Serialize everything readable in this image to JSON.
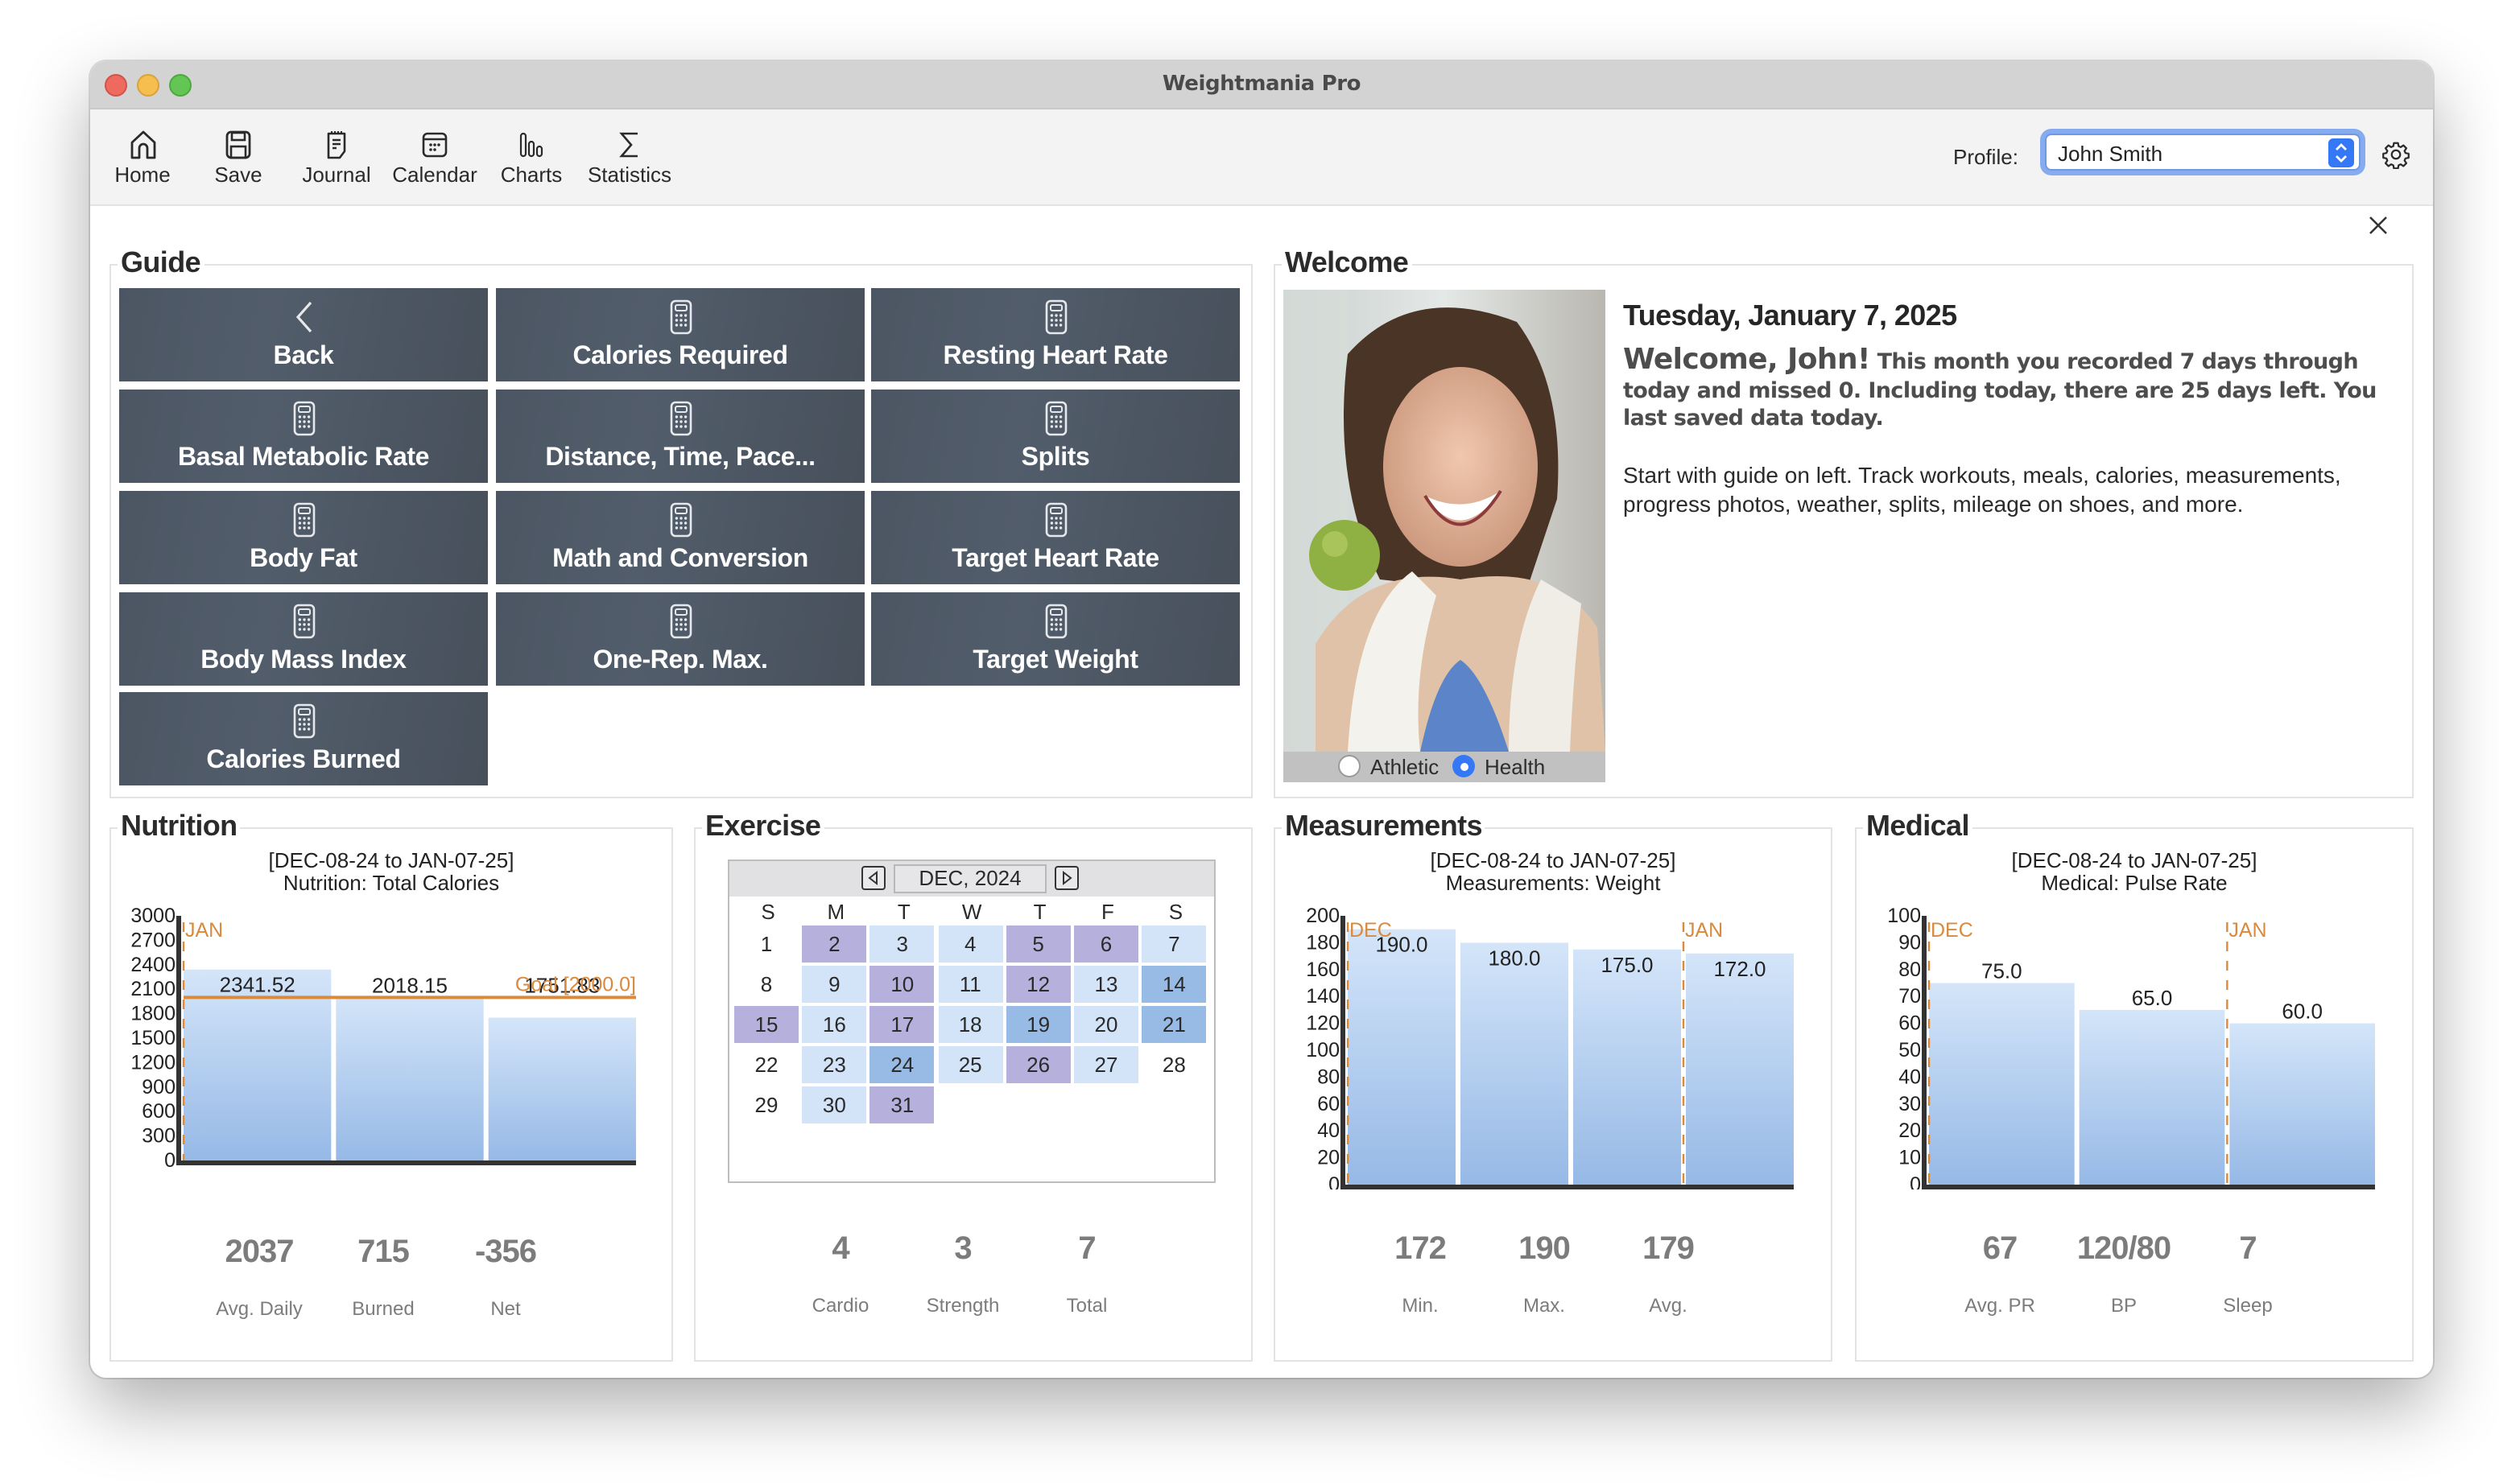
{
  "window": {
    "title": "Weightmania Pro"
  },
  "toolbar": {
    "items": [
      {
        "label": "Home",
        "icon": "home-icon"
      },
      {
        "label": "Save",
        "icon": "save-icon"
      },
      {
        "label": "Journal",
        "icon": "journal-icon"
      },
      {
        "label": "Calendar",
        "icon": "calendar-icon"
      },
      {
        "label": "Charts",
        "icon": "charts-icon"
      },
      {
        "label": "Statistics",
        "icon": "sigma-icon"
      }
    ],
    "profile_label": "Profile:",
    "profile_value": "John Smith"
  },
  "guide": {
    "title": "Guide",
    "buttons": [
      {
        "label": "Back",
        "icon": "chevron-left-icon"
      },
      {
        "label": "Calories Required",
        "icon": "calculator-icon"
      },
      {
        "label": "Resting Heart Rate",
        "icon": "calculator-icon"
      },
      {
        "label": "Basal Metabolic Rate",
        "icon": "calculator-icon"
      },
      {
        "label": "Distance, Time, Pace...",
        "icon": "calculator-icon"
      },
      {
        "label": "Splits",
        "icon": "calculator-icon"
      },
      {
        "label": "Body Fat",
        "icon": "calculator-icon"
      },
      {
        "label": "Math and Conversion",
        "icon": "calculator-icon"
      },
      {
        "label": "Target Heart Rate",
        "icon": "calculator-icon"
      },
      {
        "label": "Body Mass Index",
        "icon": "calculator-icon"
      },
      {
        "label": "One-Rep. Max.",
        "icon": "calculator-icon"
      },
      {
        "label": "Target Weight",
        "icon": "calculator-icon"
      },
      {
        "label": "Calories Burned",
        "icon": "calculator-icon"
      }
    ]
  },
  "welcome": {
    "title": "Welcome",
    "date": "Tuesday, January 7, 2025",
    "greeting": "Welcome, John!",
    "summary": " This month you recorded 7 days through today and missed 0. Including today, there are 25 days left. You last saved data today.",
    "intro": "Start with guide on left. Track workouts, meals, calories, measurements, progress photos, weather, splits, mileage on shoes, and more.",
    "mode_options": [
      {
        "label": "Athletic",
        "selected": false
      },
      {
        "label": "Health",
        "selected": true
      }
    ]
  },
  "nutrition": {
    "title": "Nutrition",
    "stats": [
      {
        "value": "2037",
        "label": "Avg. Daily"
      },
      {
        "value": "715",
        "label": "Burned"
      },
      {
        "value": "-356",
        "label": "Net"
      }
    ]
  },
  "exercise": {
    "title": "Exercise",
    "calendar": {
      "month_label": "DEC, 2024",
      "weekdays": [
        "S",
        "M",
        "T",
        "W",
        "T",
        "F",
        "S"
      ],
      "first_weekday": 0,
      "days": [
        {
          "d": 1,
          "type": "none"
        },
        {
          "d": 2,
          "type": "strength"
        },
        {
          "d": 3,
          "type": "light"
        },
        {
          "d": 4,
          "type": "light"
        },
        {
          "d": 5,
          "type": "strength"
        },
        {
          "d": 6,
          "type": "strength"
        },
        {
          "d": 7,
          "type": "light"
        },
        {
          "d": 8,
          "type": "none"
        },
        {
          "d": 9,
          "type": "light"
        },
        {
          "d": 10,
          "type": "strength"
        },
        {
          "d": 11,
          "type": "light"
        },
        {
          "d": 12,
          "type": "strength"
        },
        {
          "d": 13,
          "type": "light"
        },
        {
          "d": 14,
          "type": "cardio"
        },
        {
          "d": 15,
          "type": "strength"
        },
        {
          "d": 16,
          "type": "light"
        },
        {
          "d": 17,
          "type": "strength"
        },
        {
          "d": 18,
          "type": "light"
        },
        {
          "d": 19,
          "type": "cardio"
        },
        {
          "d": 20,
          "type": "light"
        },
        {
          "d": 21,
          "type": "cardio"
        },
        {
          "d": 22,
          "type": "none"
        },
        {
          "d": 23,
          "type": "light"
        },
        {
          "d": 24,
          "type": "cardio"
        },
        {
          "d": 25,
          "type": "light"
        },
        {
          "d": 26,
          "type": "strength"
        },
        {
          "d": 27,
          "type": "light"
        },
        {
          "d": 28,
          "type": "none"
        },
        {
          "d": 29,
          "type": "none"
        },
        {
          "d": 30,
          "type": "light"
        },
        {
          "d": 31,
          "type": "strength"
        }
      ],
      "colors": {
        "strength": "#b6b0dd",
        "light": "#d3e4f8",
        "cardio": "#98bbe6",
        "none": "transparent"
      }
    },
    "stats": [
      {
        "value": "4",
        "label": "Cardio"
      },
      {
        "value": "3",
        "label": "Strength"
      },
      {
        "value": "7",
        "label": "Total"
      }
    ]
  },
  "measurements": {
    "title": "Measurements",
    "stats": [
      {
        "value": "172",
        "label": "Min."
      },
      {
        "value": "190",
        "label": "Max."
      },
      {
        "value": "179",
        "label": "Avg."
      }
    ]
  },
  "medical": {
    "title": "Medical",
    "stats": [
      {
        "value": "67",
        "label": "Avg. PR"
      },
      {
        "value": "120/80",
        "label": "BP"
      },
      {
        "value": "7",
        "label": "Sleep"
      }
    ]
  },
  "chart_data": [
    {
      "id": "nutrition",
      "type": "bar",
      "title": "[DEC-08-24 to JAN-07-25]",
      "subtitle": "Nutrition:  Total Calories",
      "xlabel": "",
      "ylabel": "",
      "ylim": [
        0,
        3000
      ],
      "yticks": [
        0,
        300,
        600,
        900,
        1200,
        1500,
        1800,
        2100,
        2400,
        2700,
        3000
      ],
      "values": [
        2341.52,
        2018.15,
        1751.83
      ],
      "value_labels": [
        "2341.52",
        "2018.15",
        "1751.83"
      ],
      "markers": [
        {
          "label": "JAN",
          "before_bar": 0
        }
      ],
      "goal": {
        "label": "Goal [2000.0]",
        "value": 2000.0
      },
      "grid": false,
      "colors": {
        "bar_top": "#d4e5f9",
        "bar_bottom": "#96b9e6",
        "marker": "#d98a3d",
        "axis": "#333333"
      }
    },
    {
      "id": "measurements",
      "type": "bar",
      "title": "[DEC-08-24 to JAN-07-25]",
      "subtitle": "Measurements:  Weight",
      "xlabel": "",
      "ylabel": "",
      "ylim": [
        0,
        200
      ],
      "yticks": [
        0,
        20,
        40,
        60,
        80,
        100,
        120,
        140,
        160,
        180,
        200
      ],
      "values": [
        190.0,
        180.0,
        175.0,
        172.0
      ],
      "value_labels": [
        "190.0",
        "180.0",
        "175.0",
        "172.0"
      ],
      "markers": [
        {
          "label": "DEC",
          "before_bar": 0
        },
        {
          "label": "JAN",
          "before_bar": 3
        }
      ],
      "label_inside": true,
      "grid": false,
      "colors": {
        "bar_top": "#d4e5f9",
        "bar_bottom": "#96b9e6",
        "marker": "#d98a3d",
        "axis": "#333333"
      }
    },
    {
      "id": "medical",
      "type": "bar",
      "title": "[DEC-08-24 to JAN-07-25]",
      "subtitle": "Medical:  Pulse Rate",
      "xlabel": "",
      "ylabel": "",
      "ylim": [
        0,
        100
      ],
      "yticks": [
        0,
        10,
        20,
        30,
        40,
        50,
        60,
        70,
        80,
        90,
        100
      ],
      "values": [
        75.0,
        65.0,
        60.0
      ],
      "value_labels": [
        "75.0",
        "65.0",
        "60.0"
      ],
      "markers": [
        {
          "label": "DEC",
          "before_bar": 0
        },
        {
          "label": "JAN",
          "before_bar": 2
        }
      ],
      "grid": false,
      "colors": {
        "bar_top": "#d4e5f9",
        "bar_bottom": "#96b9e6",
        "marker": "#d98a3d",
        "axis": "#333333"
      }
    }
  ]
}
